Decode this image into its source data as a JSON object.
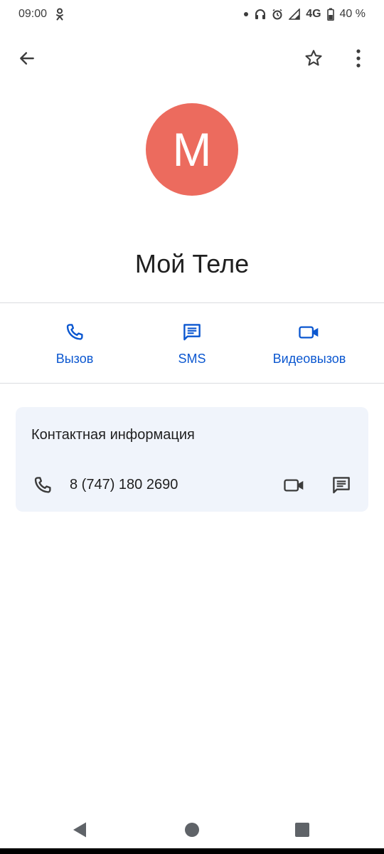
{
  "status_bar": {
    "time": "09:00",
    "network": "4G",
    "battery": "40 %",
    "icons": [
      "odnoklassniki-icon",
      "dot-icon",
      "headphones-icon",
      "alarm-icon",
      "signal-icon",
      "battery-icon"
    ]
  },
  "app_bar": {
    "back_icon": "arrow-left-icon",
    "star_icon": "star-outline-icon",
    "more_icon": "more-vertical-icon"
  },
  "contact": {
    "initial": "М",
    "name": "Мой Теле",
    "avatar_color": "#ec6b5e"
  },
  "actions": [
    {
      "label": "Вызов",
      "icon": "phone-icon"
    },
    {
      "label": "SMS",
      "icon": "message-icon"
    },
    {
      "label": "Видеовызов",
      "icon": "video-icon"
    }
  ],
  "info_card": {
    "title": "Контактная информация",
    "phone": "8 (747) 180 2690"
  },
  "colors": {
    "accent": "#0b57d0",
    "card_bg": "#f0f4fb",
    "divider": "#dadce0"
  },
  "nav": {
    "back_icon": "triangle-back-icon",
    "home_icon": "circle-home-icon",
    "recents_icon": "square-recents-icon"
  }
}
